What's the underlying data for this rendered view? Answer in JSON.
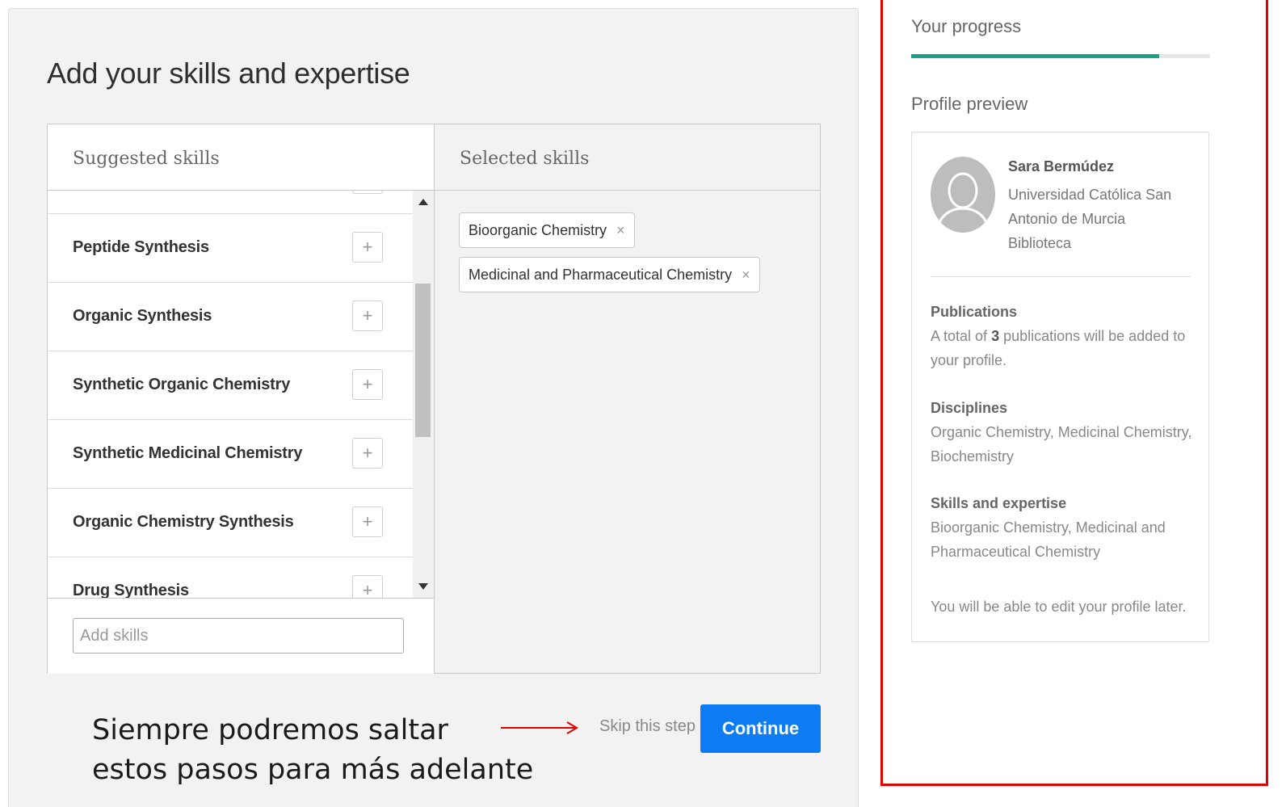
{
  "page": {
    "title": "Add your skills and expertise"
  },
  "suggested": {
    "header": "Suggested skills",
    "items": [
      {
        "label": "Peptide Synthesis"
      },
      {
        "label": "Organic Synthesis"
      },
      {
        "label": "Synthetic Organic Chemistry"
      },
      {
        "label": "Synthetic Medicinal Chemistry"
      },
      {
        "label": "Organic Chemistry Synthesis"
      },
      {
        "label": "Drug Synthesis"
      }
    ],
    "add_icon": "plus-icon",
    "add_input_placeholder": "Add skills",
    "add_input_value": ""
  },
  "selected": {
    "header": "Selected skills",
    "chips": [
      {
        "label": "Bioorganic Chemistry",
        "remove": "×"
      },
      {
        "label": "Medicinal and Pharmaceutical Chemistry",
        "remove": "×"
      }
    ]
  },
  "footer": {
    "annotation_line1": "Siempre podremos  saltar",
    "annotation_line2": "estos pasos para más adelante",
    "skip_label": "Skip this step",
    "continue_label": "Continue"
  },
  "sidebar": {
    "progress_label": "Your progress",
    "progress_fraction": 0.83,
    "preview_label": "Profile preview",
    "profile": {
      "name": "Sara Bermúdez",
      "institution": "Universidad Católica San Antonio de Murcia",
      "department": "Biblioteca"
    },
    "publications": {
      "heading": "Publications",
      "text_before": "A total of ",
      "count": "3",
      "text_after": " publications will be added to your profile."
    },
    "disciplines": {
      "heading": "Disciplines",
      "text": "Organic Chemistry, Medicinal Chemistry, Biochemistry"
    },
    "skills": {
      "heading": "Skills and expertise",
      "text": "Bioorganic Chemistry, Medicinal and Pharmaceutical Chemistry"
    },
    "footnote": "You will be able to edit your profile later."
  },
  "colors": {
    "accent": "#0d7cf2",
    "progress": "#1aa189",
    "highlight_border": "#e00000",
    "annotation_arrow": "#e00000"
  }
}
